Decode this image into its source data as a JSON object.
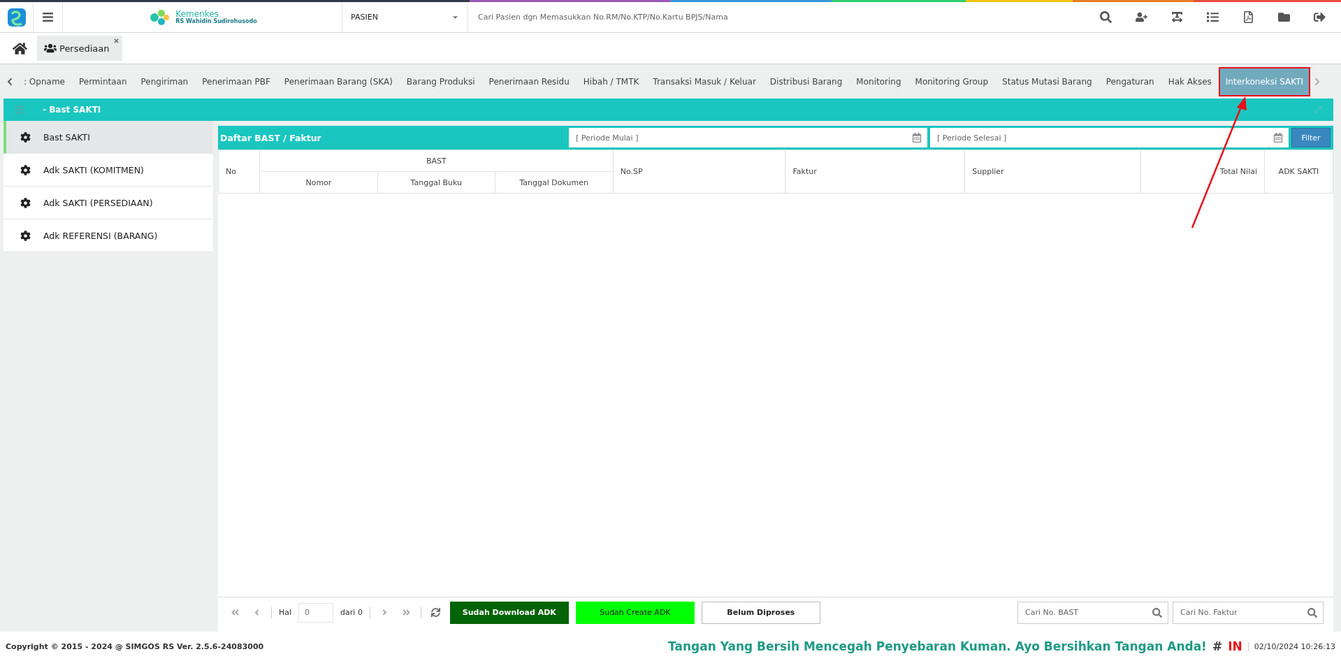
{
  "header": {
    "brand_title": "Kemenkes",
    "brand_subtitle": "RS Wahidin Sudirohusodo",
    "search_category": "PASIEN",
    "search": {
      "placeholder": "Cari Pasien dgn Memasukkan No.RM/No.KTP/No.Kartu BPJS/Nama"
    }
  },
  "open_tabs": [
    {
      "label": "Persediaan",
      "selected": true
    }
  ],
  "menu": [
    {
      "label": ": Opname",
      "selected": false
    },
    {
      "label": "Permintaan",
      "selected": false
    },
    {
      "label": "Pengiriman",
      "selected": false
    },
    {
      "label": "Penerimaan PBF",
      "selected": false
    },
    {
      "label": "Penerimaan Barang (SKA)",
      "selected": false
    },
    {
      "label": "Barang Produksi",
      "selected": false
    },
    {
      "label": "Penerimaan Residu",
      "selected": false
    },
    {
      "label": "Hibah / TMTK",
      "selected": false
    },
    {
      "label": "Transaksi Masuk / Keluar",
      "selected": false
    },
    {
      "label": "Distribusi Barang",
      "selected": false
    },
    {
      "label": "Monitoring",
      "selected": false
    },
    {
      "label": "Monitoring Group",
      "selected": false
    },
    {
      "label": "Status Mutasi Barang",
      "selected": false
    },
    {
      "label": "Pengaturan",
      "selected": false
    },
    {
      "label": "Hak Akses",
      "selected": false
    },
    {
      "label": "Interkoneksi SAKTI",
      "selected": true
    }
  ],
  "panel_title": "- Bast SAKTI",
  "sidebar": {
    "items": [
      {
        "label": "Bast SAKTI",
        "selected": true
      },
      {
        "label": "Adk SAKTI (KOMITMEN)",
        "selected": false
      },
      {
        "label": "Adk SAKTI (PERSEDIAAN)",
        "selected": false
      },
      {
        "label": "Adk REFERENSI (BARANG)",
        "selected": false
      }
    ]
  },
  "list": {
    "title": "Daftar BAST / Faktur",
    "start_date": {
      "placeholder": "[ Periode Mulai ]"
    },
    "end_date": {
      "placeholder": "[ Periode Selesai ]"
    },
    "filter_button": "Filter",
    "table": {
      "group_header": "BAST",
      "columns": [
        "No",
        "Nomor",
        "Tanggal Buku",
        "Tanggal Dokumen",
        "No.SP",
        "Faktur",
        "Supplier",
        "Total Nilai",
        "ADK SAKTI"
      ]
    }
  },
  "pager": {
    "page_label": "Hal",
    "page_input": {
      "placeholder": "0"
    },
    "of_label": "dari 0"
  },
  "status_buttons": [
    "Sudah Download ADK",
    "Sudah Create ADK",
    "Belum Diproses"
  ],
  "search_bast": {
    "placeholder": "Cari No. BAST"
  },
  "search_faktur": {
    "placeholder": "Cari No. Faktur"
  },
  "footer": {
    "copyright": "Copyright © 2015 - 2024 @ SIMGOS RS Ver. 2.5.6-24083000",
    "message": "Tangan Yang Bersih Mencegah Penyebaran Kuman. Ayo Bersihkan Tangan Anda!",
    "hash": "#",
    "tag": "IN",
    "datetime": "02/10/2024 10:26:13"
  },
  "annotations": {
    "highlight_box": true,
    "arrow": true
  }
}
